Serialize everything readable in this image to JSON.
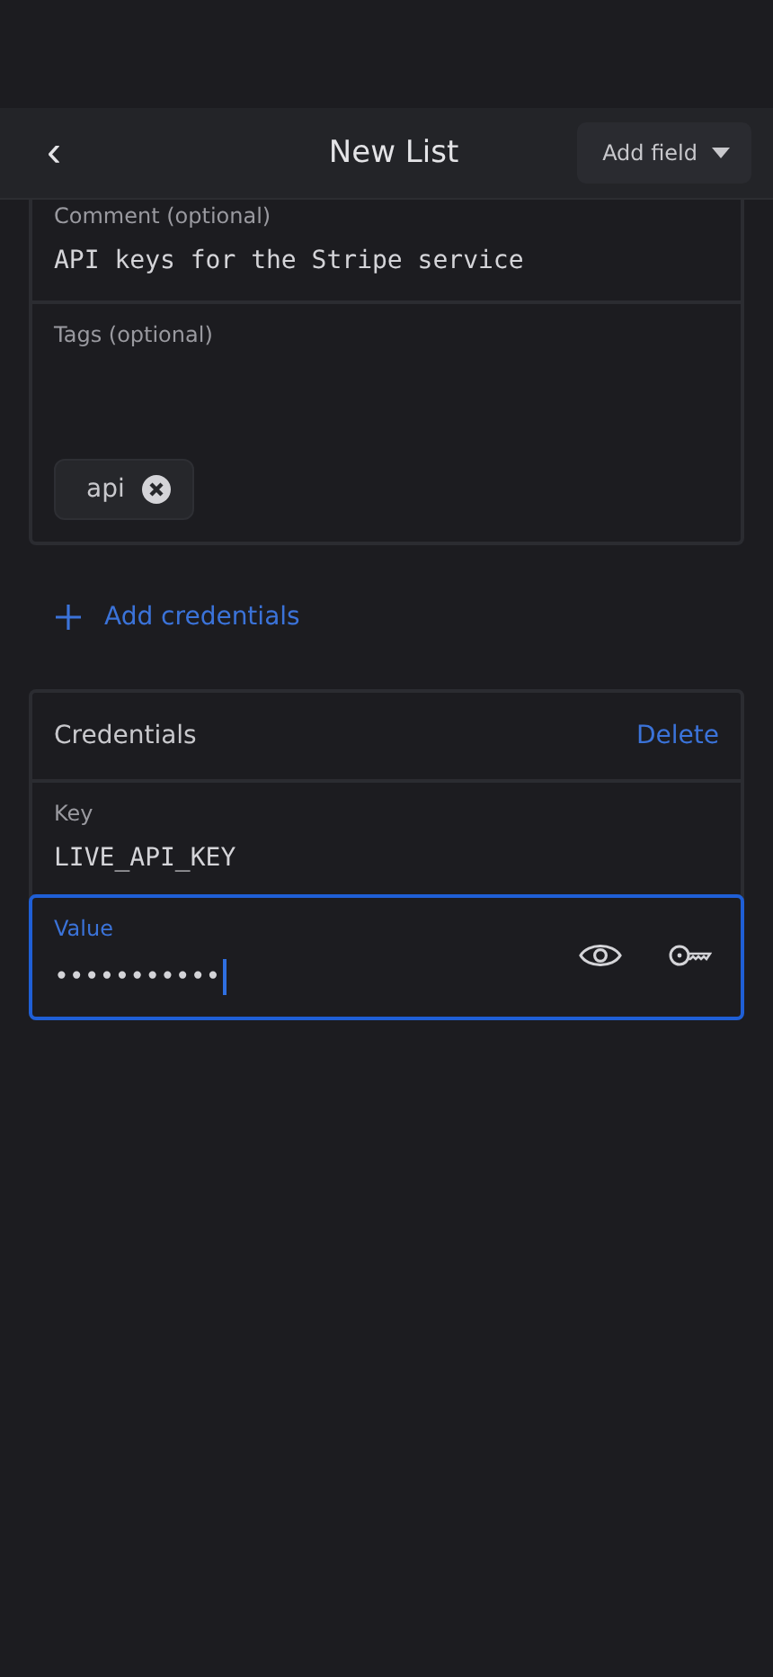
{
  "header": {
    "back_icon": "‹",
    "title": "New List",
    "add_field": "Add field"
  },
  "comment": {
    "label": "Comment (optional)",
    "value": "API keys for the Stripe service"
  },
  "tags": {
    "label": "Tags (optional)",
    "items": [
      {
        "label": "api"
      }
    ]
  },
  "add_credentials": "Add credentials",
  "credentials": {
    "title": "Credentials",
    "delete": "Delete",
    "fields": [
      {
        "kind": "text",
        "label": "Key",
        "value": "LIVE_API_KEY",
        "focused": false
      },
      {
        "kind": "secret",
        "label": "Value",
        "value": "•••••••••••",
        "focused": true
      }
    ]
  }
}
